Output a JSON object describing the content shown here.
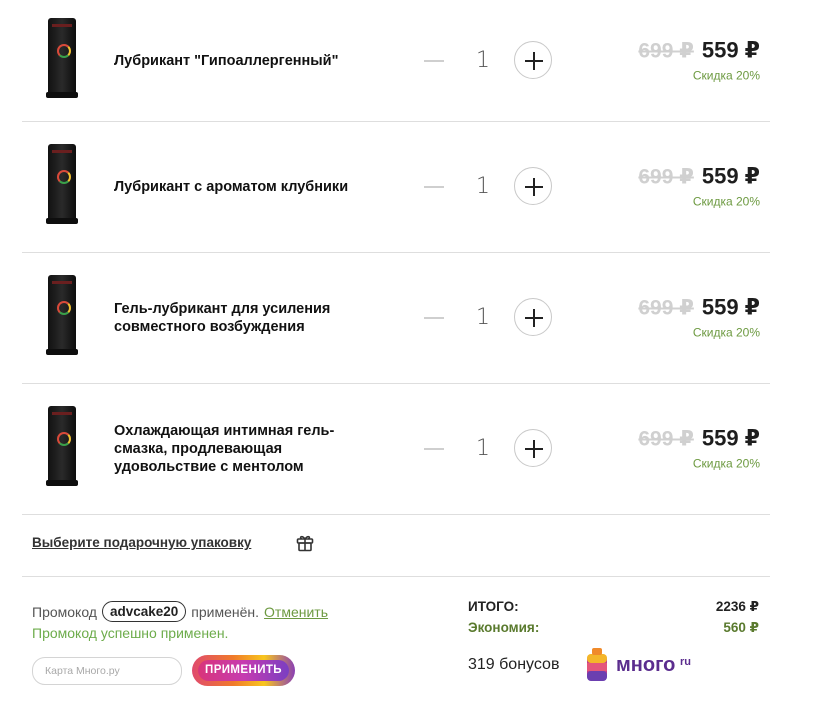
{
  "items": [
    {
      "name": "Лубрикант \"Гипоаллергенный\"",
      "qty": "1",
      "old_price": "699 ₽",
      "price": "559 ₽",
      "discount": "Скидка 20%"
    },
    {
      "name": "Лубрикант с ароматом клубники",
      "qty": "1",
      "old_price": "699 ₽",
      "price": "559 ₽",
      "discount": "Скидка 20%"
    },
    {
      "name": "Гель-лубрикант для усиления совместного возбуждения",
      "qty": "1",
      "old_price": "699 ₽",
      "price": "559 ₽",
      "discount": "Скидка 20%"
    },
    {
      "name": "Охлаждающая интимная гель-смазка, продлевающая удовольствие с ментолом",
      "qty": "1",
      "old_price": "699 ₽",
      "price": "559 ₽",
      "discount": "Скидка 20%"
    }
  ],
  "gift": {
    "label": "Выберите подарочную упаковку",
    "icon": "gift-icon"
  },
  "promo": {
    "prefix": "Промокод",
    "code": "advcake20",
    "applied": "применён.",
    "cancel": "Отменить",
    "success": "Промокод успешно применен.",
    "card_placeholder": "Карта Много.ру",
    "apply_label": "ПРИМЕНИТЬ"
  },
  "totals": {
    "total_label": "ИТОГО:",
    "total_value": "2236 ₽",
    "savings_label": "Экономия:",
    "savings_value": "560 ₽",
    "bonus": "319 бонусов",
    "brand": "много",
    "brand_suffix": "ru"
  },
  "colors": {
    "accent_green": "#6d9a41",
    "brand_purple": "#5b2d8e"
  }
}
